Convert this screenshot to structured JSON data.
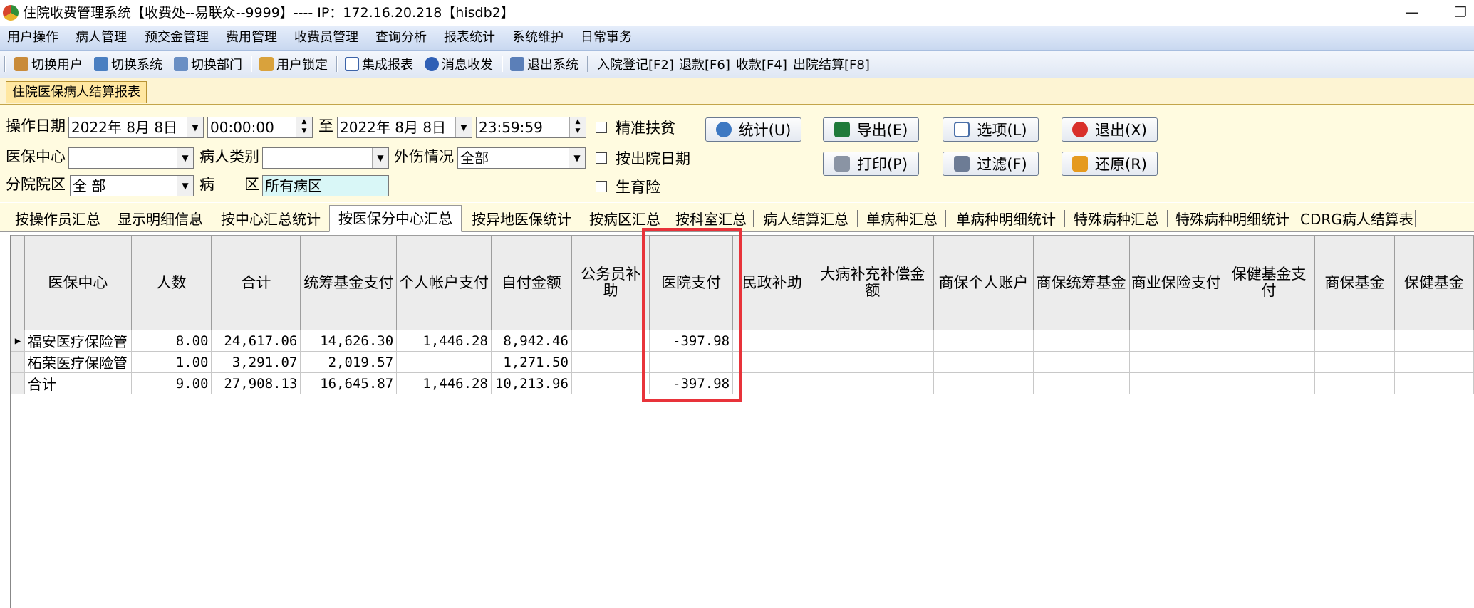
{
  "window": {
    "title": "住院收费管理系统【收费处--易联众--9999】---- IP：172.16.20.218【hisdb2】",
    "minimize": "—",
    "restore": "❐"
  },
  "menu": [
    "用户操作",
    "病人管理",
    "预交金管理",
    "费用管理",
    "收费员管理",
    "查询分析",
    "报表统计",
    "系统维护",
    "日常事务"
  ],
  "toolbar": {
    "switch_user": "切换用户",
    "switch_system": "切换系统",
    "switch_dept": "切换部门",
    "lock_user": "用户锁定",
    "integrated_report": "集成报表",
    "message": "消息收发",
    "exit_system": "退出系统",
    "admission": "入院登记[F2]",
    "refund": "退款[F6]",
    "collect": "收款[F4]",
    "discharge": "出院结算[F8]"
  },
  "doc_tab": "住院医保病人结算报表",
  "filters": {
    "op_date_label": "操作日期",
    "start_date": "2022年 8月 8日",
    "start_time": "00:00:00",
    "to_label": "至",
    "end_date": "2022年 8月 8日",
    "end_time": "23:59:59",
    "insurance_center_label": "医保中心",
    "insurance_center_value": "",
    "patient_type_label": "病人类别",
    "patient_type_value": "",
    "injury_label": "外伤情况",
    "injury_value": "全部",
    "branch_label": "分院院区",
    "branch_value": "全 部",
    "ward_label_1": "病",
    "ward_label_2": "区",
    "ward_value": "所有病区",
    "chk_poverty": "精准扶贫",
    "chk_discharge_date": "按出院日期",
    "chk_maternity": "生育险"
  },
  "buttons": {
    "stats": "统计(U)",
    "export": "导出(E)",
    "options": "选项(L)",
    "exit": "退出(X)",
    "print": "打印(P)",
    "filter": "过滤(F)",
    "restore": "还原(R)"
  },
  "tabs": [
    "按操作员汇总",
    "显示明细信息",
    "按中心汇总统计",
    "按医保分中心汇总",
    "按异地医保统计",
    "按病区汇总",
    "按科室汇总",
    "病人结算汇总",
    "单病种汇总",
    "单病种明细统计",
    "特殊病种汇总",
    "特殊病种明细统计",
    "CDRG病人结算表"
  ],
  "active_tab": 3,
  "grid": {
    "headers": [
      "医保中心",
      "人数",
      "合计",
      "统筹基金支付",
      "个人帐户支付",
      "自付金额",
      "公务员补助",
      "医院支付",
      "民政补助",
      "大病补充补偿金额",
      "商保个人账户",
      "商保统筹基金",
      "商业保险支付",
      "保健基金支付",
      "商保基金",
      "保健基金"
    ],
    "rows": [
      {
        "indicator": "▶",
        "cells": [
          "福安医疗保险管",
          "8.00",
          "24,617.06",
          "14,626.30",
          "1,446.28",
          "8,942.46",
          "",
          "-397.98",
          "",
          "",
          "",
          "",
          "",
          "",
          "",
          ""
        ]
      },
      {
        "indicator": "",
        "cells": [
          "柘荣医疗保险管",
          "1.00",
          "3,291.07",
          "2,019.57",
          "",
          "1,271.50",
          "",
          "",
          "",
          "",
          "",
          "",
          "",
          "",
          "",
          ""
        ]
      },
      {
        "indicator": "",
        "cells": [
          "合计",
          "9.00",
          "27,908.13",
          "16,645.87",
          "1,446.28",
          "10,213.96",
          "",
          "-397.98",
          "",
          "",
          "",
          "",
          "",
          "",
          "",
          ""
        ]
      }
    ]
  },
  "colors": {
    "highlight": "#e8333a",
    "filter_bg": "#fffbe0",
    "menubar": "#c9d8f0"
  }
}
